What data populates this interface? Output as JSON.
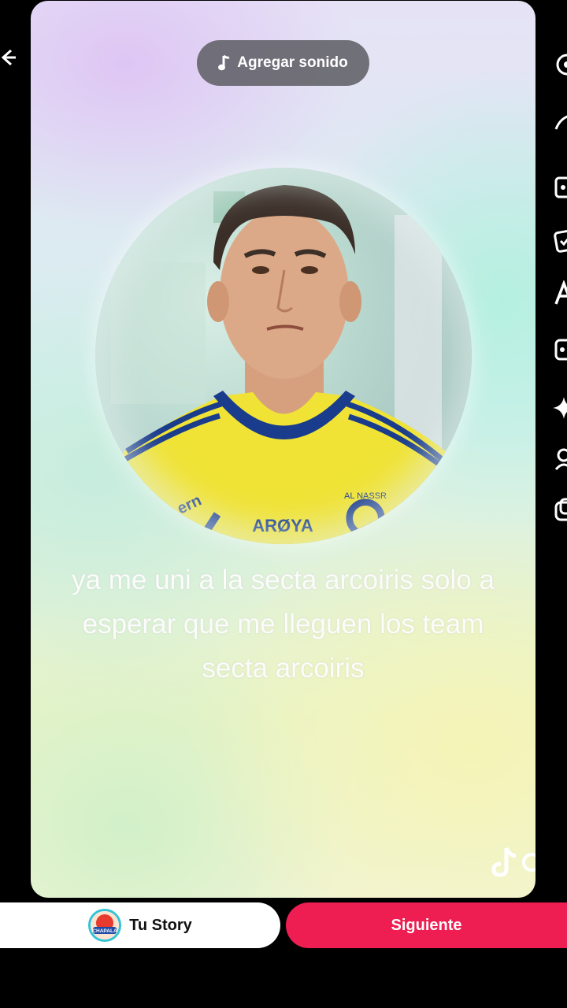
{
  "top": {
    "sound_label": "Agregar sonido",
    "sound_icon": "music-note-icon"
  },
  "preview": {
    "caption_lines": [
      "ya me uni a la secta arcoiris solo a",
      "esperar que me lleguen los team",
      "secta arcoiris"
    ],
    "jersey_text": "ARØYA",
    "jersey_partial": "ern",
    "crest_text": "AL NASSR",
    "background_colors": [
      "#e2d3f4",
      "#c8efe4",
      "#f2f3c4"
    ]
  },
  "side_tools": [
    "settings-icon",
    "text-icon",
    "stickers-icon",
    "effects-icon",
    "text-A-icon",
    "filters-icon",
    "sparkle-icon",
    "voice-icon",
    "captions-icon"
  ],
  "bottom": {
    "story_label": "Tu Story",
    "avatar_text": "CHAPALA",
    "next_label": "Siguiente",
    "next_color": "#ee1d52"
  }
}
